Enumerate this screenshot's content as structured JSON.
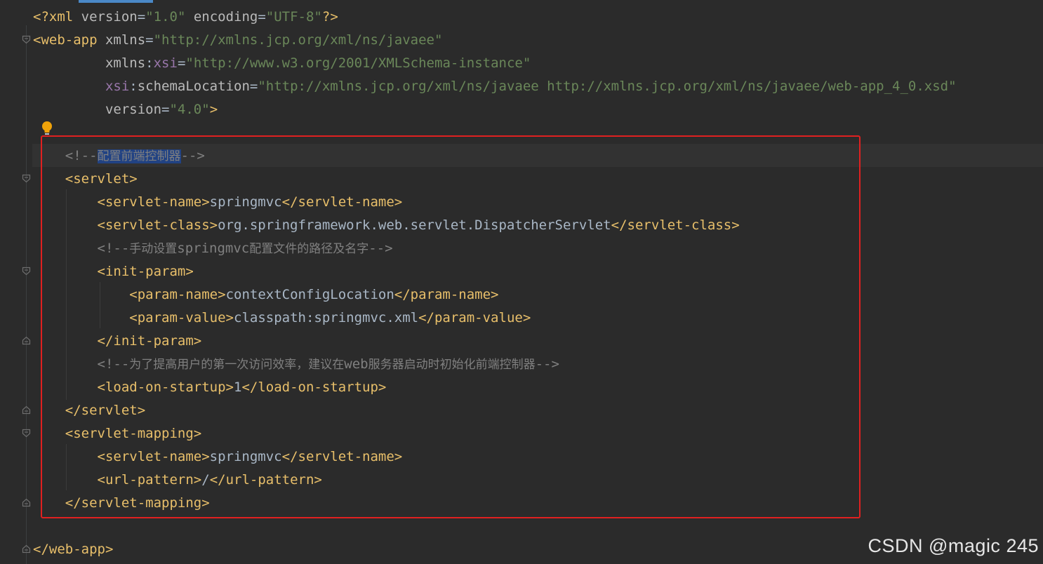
{
  "editor": {
    "lines": [
      {
        "parts": [
          [
            "t",
            "<?"
          ],
          [
            "t",
            "xml"
          ],
          [
            "attr",
            " version"
          ],
          [
            "txt",
            "="
          ],
          [
            "str",
            "\"1.0\""
          ],
          [
            "attr",
            " encoding"
          ],
          [
            "txt",
            "="
          ],
          [
            "str",
            "\"UTF-8\""
          ],
          [
            "t",
            "?>"
          ]
        ]
      },
      {
        "parts": [
          [
            "t",
            "<web-app"
          ],
          [
            "attr",
            " xmlns"
          ],
          [
            "txt",
            "="
          ],
          [
            "str",
            "\"http://xmlns.jcp.org/xml/ns/javaee\""
          ]
        ]
      },
      {
        "parts": [
          [
            "txt",
            "         "
          ],
          [
            "attr",
            "xmlns"
          ],
          [
            "txt",
            ":"
          ],
          [
            "ns",
            "xsi"
          ],
          [
            "txt",
            "="
          ],
          [
            "str",
            "\"http://www.w3.org/2001/XMLSchema-instance\""
          ]
        ]
      },
      {
        "parts": [
          [
            "txt",
            "         "
          ],
          [
            "ns",
            "xsi"
          ],
          [
            "txt",
            ":"
          ],
          [
            "attr",
            "schemaLocation"
          ],
          [
            "txt",
            "="
          ],
          [
            "str",
            "\"http://xmlns.jcp.org/xml/ns/javaee http://xmlns.jcp.org/xml/ns/javaee/web-app_4_0.xsd\""
          ]
        ]
      },
      {
        "parts": [
          [
            "txt",
            "         "
          ],
          [
            "attr",
            "version"
          ],
          [
            "txt",
            "="
          ],
          [
            "str",
            "\"4.0\""
          ],
          [
            "t",
            ">"
          ]
        ]
      },
      {
        "parts": []
      },
      {
        "parts": [
          [
            "txt",
            "    "
          ],
          [
            "cm",
            "<!--"
          ],
          [
            "sel",
            "配置前端控制器"
          ],
          [
            "cm",
            "-->"
          ]
        ]
      },
      {
        "parts": [
          [
            "txt",
            "    "
          ],
          [
            "t",
            "<servlet>"
          ]
        ]
      },
      {
        "parts": [
          [
            "txt",
            "        "
          ],
          [
            "t",
            "<servlet-name>"
          ],
          [
            "txt",
            "springmvc"
          ],
          [
            "t",
            "</servlet-name>"
          ]
        ]
      },
      {
        "parts": [
          [
            "txt",
            "        "
          ],
          [
            "t",
            "<servlet-class>"
          ],
          [
            "txt",
            "org.springframework.web.servlet.DispatcherServlet"
          ],
          [
            "t",
            "</servlet-class>"
          ]
        ]
      },
      {
        "parts": [
          [
            "txt",
            "        "
          ],
          [
            "cm",
            "<!--"
          ],
          [
            "cjk",
            "手动设置"
          ],
          [
            "cm",
            "springmvc"
          ],
          [
            "cjk",
            "配置文件的路径及名字"
          ],
          [
            "cm",
            "-->"
          ]
        ]
      },
      {
        "parts": [
          [
            "txt",
            "        "
          ],
          [
            "t",
            "<init-param>"
          ]
        ]
      },
      {
        "parts": [
          [
            "txt",
            "            "
          ],
          [
            "t",
            "<param-name>"
          ],
          [
            "txt",
            "contextConfigLocation"
          ],
          [
            "t",
            "</param-name>"
          ]
        ]
      },
      {
        "parts": [
          [
            "txt",
            "            "
          ],
          [
            "t",
            "<param-value>"
          ],
          [
            "txt",
            "classpath:springmvc.xml"
          ],
          [
            "t",
            "</param-value>"
          ]
        ]
      },
      {
        "parts": [
          [
            "txt",
            "        "
          ],
          [
            "t",
            "</init-param>"
          ]
        ]
      },
      {
        "parts": [
          [
            "txt",
            "        "
          ],
          [
            "cm",
            "<!--"
          ],
          [
            "cjk",
            "为了提高用户的第一次访问效率，建议在"
          ],
          [
            "cm",
            "web"
          ],
          [
            "cjk",
            "服务器启动时初始化前端控制器"
          ],
          [
            "cm",
            "-->"
          ]
        ]
      },
      {
        "parts": [
          [
            "txt",
            "        "
          ],
          [
            "t",
            "<load-on-startup>"
          ],
          [
            "txt",
            "1"
          ],
          [
            "t",
            "</load-on-startup>"
          ]
        ]
      },
      {
        "parts": [
          [
            "txt",
            "    "
          ],
          [
            "t",
            "</servlet>"
          ]
        ]
      },
      {
        "parts": [
          [
            "txt",
            "    "
          ],
          [
            "t",
            "<servlet-mapping>"
          ]
        ]
      },
      {
        "parts": [
          [
            "txt",
            "        "
          ],
          [
            "t",
            "<servlet-name>"
          ],
          [
            "txt",
            "springmvc"
          ],
          [
            "t",
            "</servlet-name>"
          ]
        ]
      },
      {
        "parts": [
          [
            "txt",
            "        "
          ],
          [
            "t",
            "<url-pattern>"
          ],
          [
            "txt",
            "/"
          ],
          [
            "t",
            "</url-pattern>"
          ]
        ]
      },
      {
        "parts": [
          [
            "txt",
            "    "
          ],
          [
            "t",
            "</servlet-mapping>"
          ]
        ]
      },
      {
        "parts": []
      },
      {
        "parts": [
          [
            "t",
            "</web-app>"
          ]
        ]
      }
    ]
  },
  "icons": {
    "intention": "lightbulb-icon",
    "fold_open": "fold-open-icon",
    "fold_close": "fold-close-icon"
  },
  "colors": {
    "background": "#2b2b2b",
    "tag": "#e8bf6a",
    "string": "#6a8759",
    "comment": "#808080",
    "namespace": "#9876aa",
    "selection": "#214283",
    "highlight_box": "#e02020"
  },
  "watermark": "CSDN @magic 245"
}
